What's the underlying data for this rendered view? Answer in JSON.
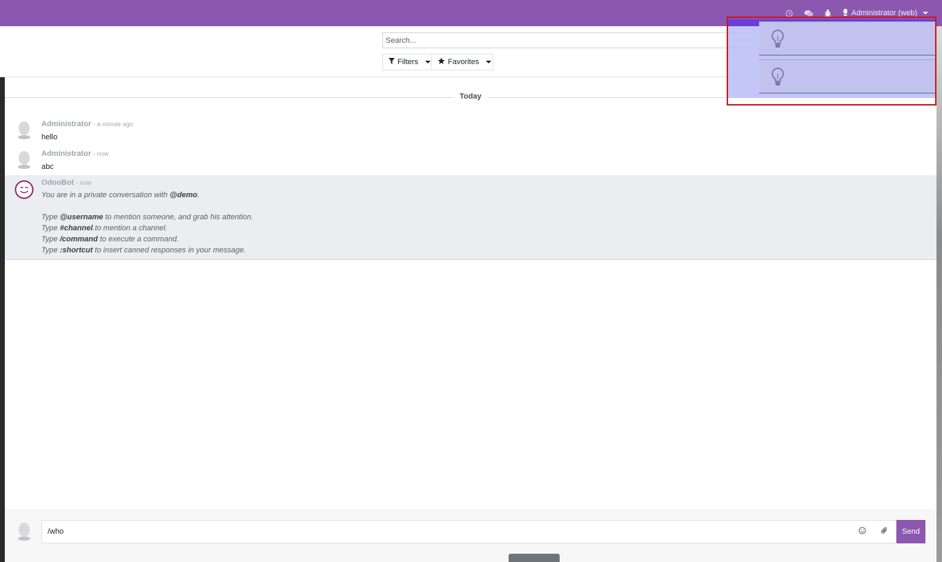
{
  "topbar": {
    "user_label": "Administrator (web)",
    "icons": [
      "clock-icon",
      "chat-icon",
      "bug-icon",
      "user-icon"
    ],
    "accent": "#8c57ae"
  },
  "control_panel": {
    "search_placeholder": "Search...",
    "filters_label": "Filters",
    "favorites_label": "Favorites"
  },
  "thread": {
    "day_separator": "Today",
    "messages": [
      {
        "author": "Administrator",
        "date": "- a minute ago",
        "body": "hello"
      },
      {
        "author": "Administrator",
        "date": "- now",
        "body": "abc"
      }
    ],
    "bot_message": {
      "author": "OdooBot",
      "date": "- now",
      "intro_prefix": "You are in a private conversation with ",
      "intro_mention": "@demo",
      "intro_suffix": ".",
      "lines": [
        {
          "prefix": "Type ",
          "keyword": "@username",
          "suffix": " to mention someone, and grab his attention."
        },
        {
          "prefix": "Type ",
          "keyword": "#channel",
          "suffix": ".to mention a channel."
        },
        {
          "prefix": "Type ",
          "keyword": "/command",
          "suffix": " to execute a command."
        },
        {
          "prefix": "Type ",
          "keyword": ":shortcut",
          "suffix": " to insert canned responses in your message."
        }
      ]
    }
  },
  "composer": {
    "value": "/who",
    "send_label": "Send"
  },
  "notifications": {
    "items": [
      "lightbulb-icon",
      "lightbulb-icon"
    ]
  }
}
